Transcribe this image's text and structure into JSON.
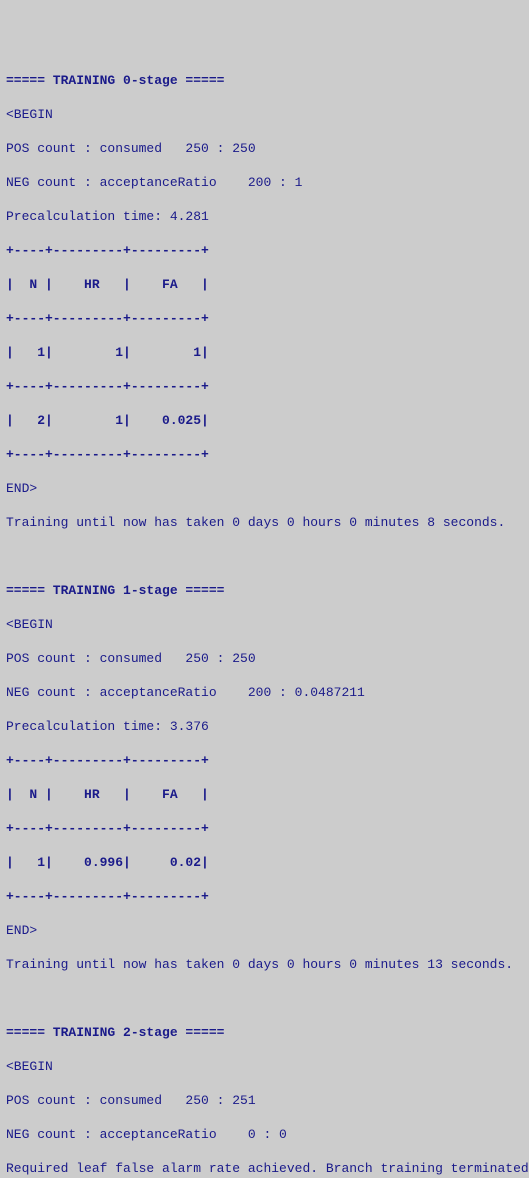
{
  "stages": [
    {
      "header": "===== TRAINING 0-stage =====",
      "begin": "<BEGIN",
      "pos_line": "POS count : consumed   250 : 250",
      "neg_line": "NEG count : acceptanceRatio    200 : 1",
      "precalc_line": "Precalculation time: 4.281",
      "table_sep": "+----+---------+---------+",
      "table_header": "|  N |    HR   |    FA   |",
      "rows": [
        "|   1|        1|        1|",
        "|   2|        1|    0.025|"
      ],
      "end": "END>",
      "elapsed": "Training until now has taken 0 days 0 hours 0 minutes 8 seconds."
    },
    {
      "header": "===== TRAINING 1-stage =====",
      "begin": "<BEGIN",
      "pos_line": "POS count : consumed   250 : 250",
      "neg_line": "NEG count : acceptanceRatio    200 : 0.0487211",
      "precalc_line": "Precalculation time: 3.376",
      "table_sep": "+----+---------+---------+",
      "table_header": "|  N |    HR   |    FA   |",
      "rows": [
        "|   1|    0.996|     0.02|"
      ],
      "end": "END>",
      "elapsed": "Training until now has taken 0 days 0 hours 0 minutes 13 seconds."
    },
    {
      "header": "===== TRAINING 2-stage =====",
      "begin": "<BEGIN",
      "pos_line": "POS count : consumed   250 : 251",
      "neg_line": "NEG count : acceptanceRatio    0 : 0",
      "final_msg": "Required leaf false alarm rate achieved. Branch training terminated."
    }
  ]
}
